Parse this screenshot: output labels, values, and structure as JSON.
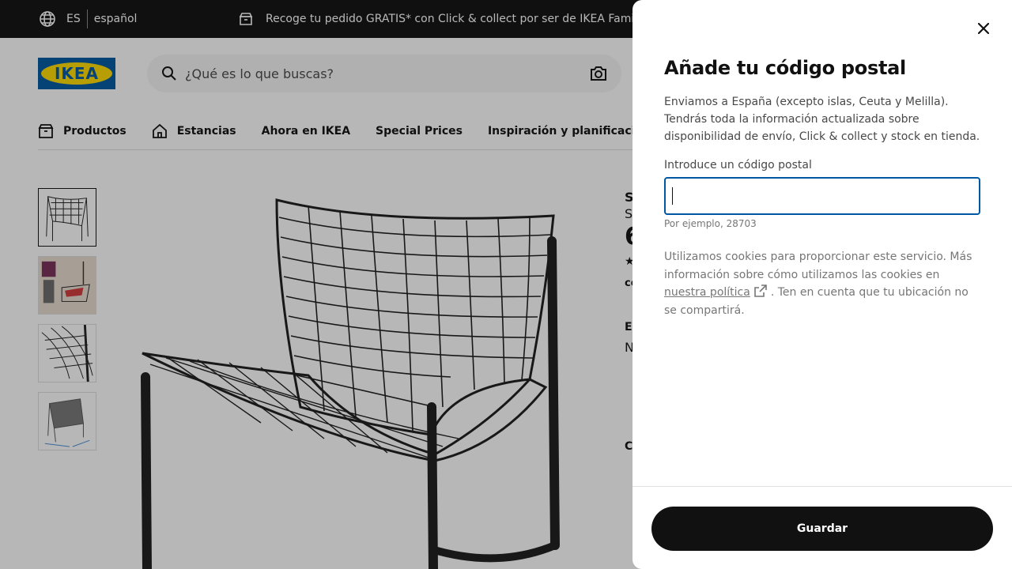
{
  "topbar": {
    "lang_code": "ES",
    "lang_name": "español",
    "promo": "Recoge tu pedido GRATIS* con Click & collect por ser de IKEA Family"
  },
  "header": {
    "logo_text": "IKEA",
    "search_placeholder": "¿Qué es lo que buscas?"
  },
  "nav": {
    "items": [
      {
        "label": "Productos",
        "icon": "box-icon"
      },
      {
        "label": "Estancias",
        "icon": "house-icon"
      },
      {
        "label": "Ahora en IKEA"
      },
      {
        "label": "Special Prices"
      },
      {
        "label": "Inspiración y planificación"
      }
    ]
  },
  "product_peek": {
    "lines": [
      "S",
      "S",
      "6",
      "★",
      "co",
      "El",
      "N",
      "C"
    ]
  },
  "modal": {
    "title": "Añade tu código postal",
    "description": "Enviamos a España (excepto islas, Ceuta y Melilla). Tendrás toda la información actualizada sobre disponibilidad de envío, Click & collect y stock en tienda.",
    "field_label": "Introduce un código postal",
    "field_value": "",
    "field_hint": "Por ejemplo, 28703",
    "cookie_text_before": "Utilizamos cookies para proporcionar este servicio. Más información sobre cómo utilizamos las cookies en",
    "cookie_link": "nuestra política",
    "cookie_text_after": ". Ten en cuenta que tu ubicación no se compartirá.",
    "save_label": "Guardar"
  },
  "colors": {
    "accent_blue": "#0058a3",
    "ikea_yellow": "#ffdb00",
    "dark": "#111111"
  }
}
